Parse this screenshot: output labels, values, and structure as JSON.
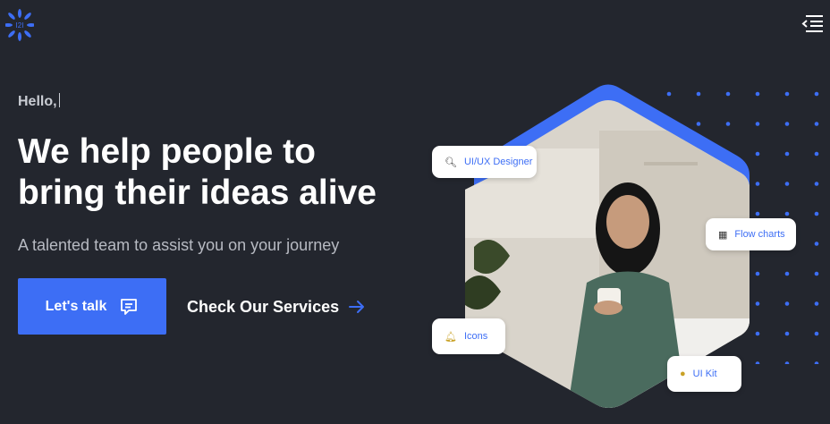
{
  "header": {
    "logo_icon": "sunburst-logo-icon",
    "menu_icon": "menu-collapse-icon"
  },
  "hero": {
    "greeting": "Hello,",
    "headline_line1": "We help people to",
    "headline_line2": "bring their ideas alive",
    "subtitle": "A talented team to assist you on your journey",
    "primary_cta": "Let's talk",
    "primary_cta_icon": "chat-icon",
    "secondary_cta": "Check Our Services",
    "secondary_cta_icon": "arrow-right-icon"
  },
  "tags": {
    "uiux": "UI/UX Designer",
    "flow": "Flow charts",
    "icons": "Icons",
    "uikit": "UI Kit"
  },
  "colors": {
    "background": "#23262e",
    "accent": "#3d6ef5",
    "card": "#ffffff"
  }
}
